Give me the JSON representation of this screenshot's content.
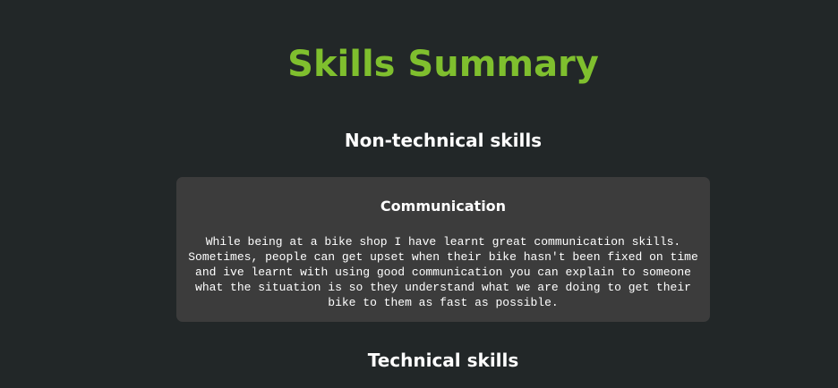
{
  "page": {
    "title": "Skills Summary",
    "sections": {
      "non_technical": {
        "heading": "Non-technical skills",
        "cards": [
          {
            "title": "Communication",
            "text": "While being at a bike shop I have learnt great communication skills. Sometimes, people can get upset when their bike hasn't been fixed on time and ive learnt with using good communication you can explain to someone what the situation is so they understand what we are doing to get their bike to them as fast as possible."
          }
        ]
      },
      "technical": {
        "heading": "Technical skills"
      }
    }
  },
  "colors": {
    "background": "#222728",
    "title": "#7fbf2e",
    "card_background": "#3c3c3c",
    "text": "#ffffff"
  }
}
